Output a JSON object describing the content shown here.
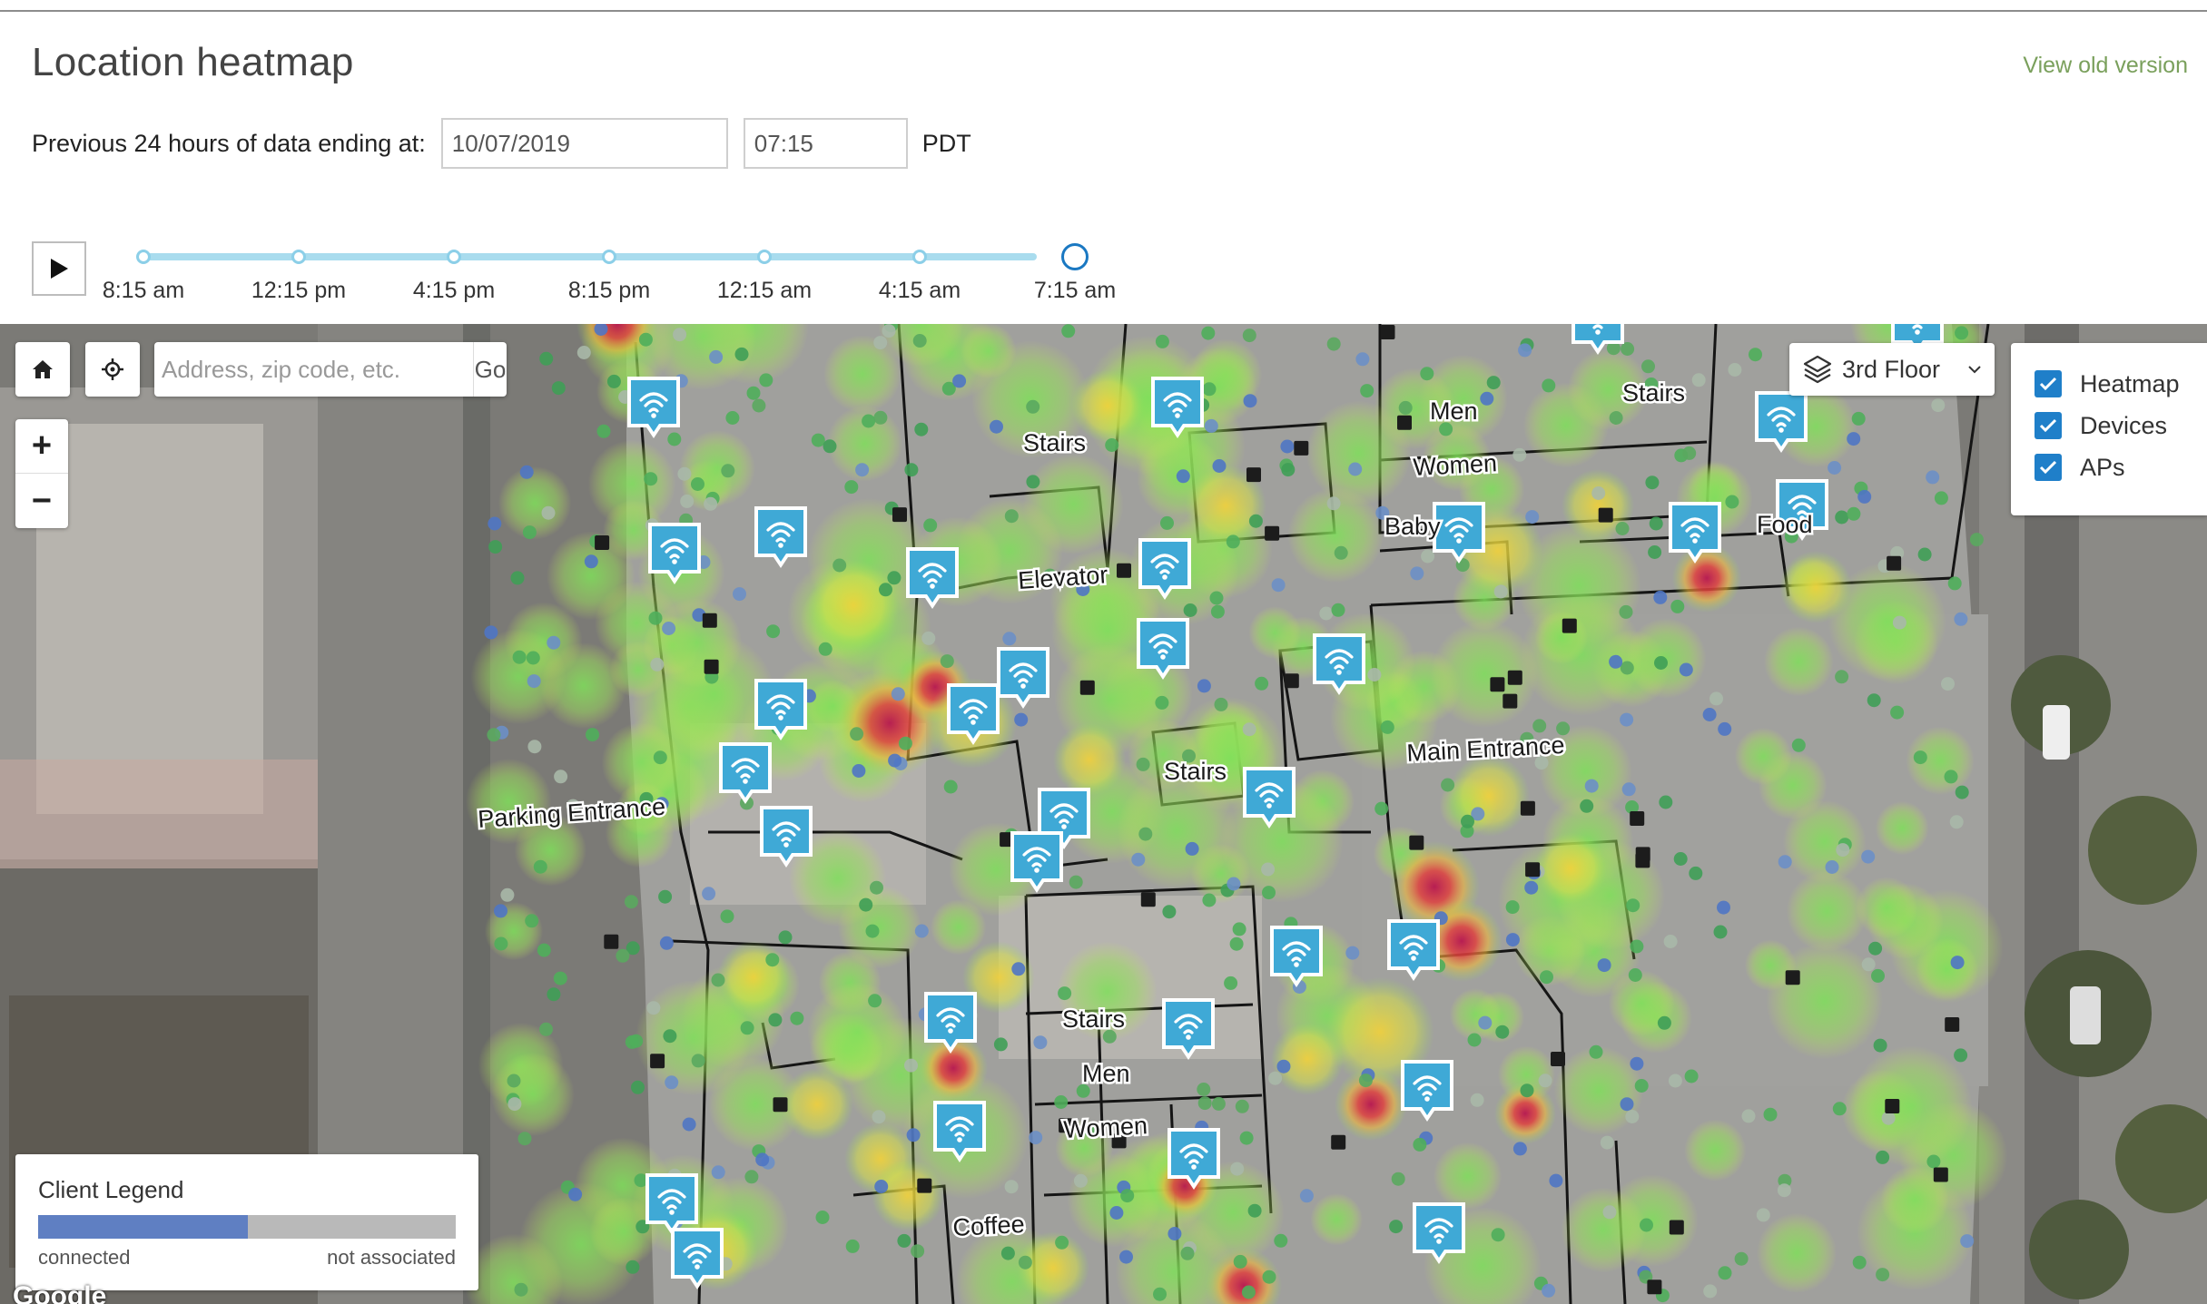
{
  "page": {
    "title": "Location heatmap",
    "old_version_link": "View old version"
  },
  "filter": {
    "label": "Previous 24 hours of data ending at:",
    "date": "10/07/2019",
    "time": "07:15",
    "timezone": "PDT"
  },
  "timeline": {
    "labels": [
      "8:15 am",
      "12:15 pm",
      "4:15 pm",
      "8:15 pm",
      "12:15 am",
      "4:15 am",
      "7:15 am"
    ],
    "selected_label": "7:15 am"
  },
  "map": {
    "search_placeholder": "Address, zip code, etc.",
    "go_label": "Go",
    "zoom_in": "+",
    "zoom_out": "−",
    "floor": "3rd Floor",
    "layers": [
      {
        "label": "Heatmap",
        "checked": true
      },
      {
        "label": "Devices",
        "checked": true
      },
      {
        "label": "APs",
        "checked": true
      }
    ],
    "place_labels": [
      "Stairs",
      "Elevator",
      "Stairs",
      "Parking Entrance",
      "Main Entrance",
      "Stairs",
      "Men",
      "Women",
      "Coffee",
      "Men",
      "Women",
      "Stairs",
      "Baby",
      "Food"
    ],
    "attribution": "Google"
  },
  "legend": {
    "title": "Client Legend",
    "left_label": "connected",
    "right_label": "not associated",
    "connected_color": "#5f7fc2",
    "not_associated_color": "#b9b9b9"
  },
  "colors": {
    "ap_marker": "#3fa9d6",
    "accent": "#1f7fc9",
    "link": "#7aa05c"
  }
}
